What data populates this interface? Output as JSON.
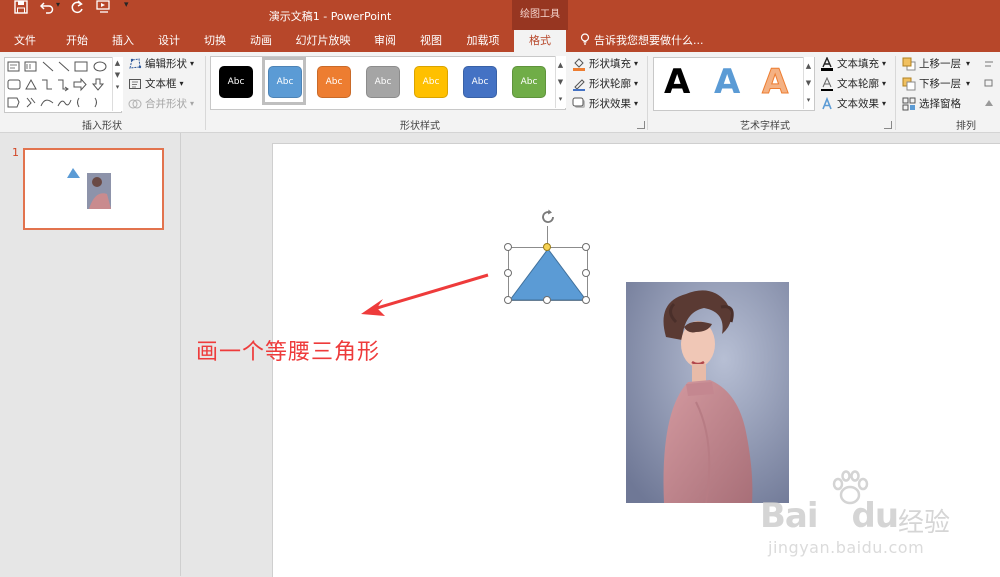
{
  "window": {
    "title": "演示文稿1 - PowerPoint",
    "context_tab_label": "绘图工具"
  },
  "quick_access": {
    "icons": [
      "save-icon",
      "undo-icon",
      "undo-dropdown-icon",
      "redo-icon",
      "start-from-beginning-icon",
      "customize-icon"
    ]
  },
  "tabs": [
    {
      "label": "文件"
    },
    {
      "label": "开始"
    },
    {
      "label": "插入"
    },
    {
      "label": "设计"
    },
    {
      "label": "切换"
    },
    {
      "label": "动画"
    },
    {
      "label": "幻灯片放映"
    },
    {
      "label": "审阅"
    },
    {
      "label": "视图"
    },
    {
      "label": "加载项"
    },
    {
      "label": "格式",
      "active": true
    }
  ],
  "tell_me": "告诉我您想要做什么...",
  "ribbon": {
    "insert_shapes": {
      "label": "插入形状",
      "edit_shape": "编辑形状",
      "text_box": "文本框",
      "merge_shapes": "合并形状"
    },
    "shape_styles": {
      "label": "形状样式",
      "sample_text": "Abc",
      "presets": [
        {
          "fill": "#000000",
          "text_color": "#ffffff"
        },
        {
          "fill": "#5b9bd5",
          "text_color": "#ffffff",
          "selected": true
        },
        {
          "fill": "#ed7d31",
          "text_color": "#ffffff"
        },
        {
          "fill": "#a5a5a5",
          "text_color": "#ffffff"
        },
        {
          "fill": "#ffc000",
          "text_color": "#ffffff"
        },
        {
          "fill": "#4472c4",
          "text_color": "#ffffff"
        },
        {
          "fill": "#70ad47",
          "text_color": "#ffffff"
        }
      ],
      "shape_fill": "形状填充",
      "shape_outline": "形状轮廓",
      "shape_effects": "形状效果"
    },
    "wordart_styles": {
      "label": "艺术字样式",
      "samples": [
        {
          "text": "A",
          "color": "#000000"
        },
        {
          "text": "A",
          "color": "#5b9bd5"
        },
        {
          "text": "A",
          "color": "#f4b183"
        }
      ],
      "text_fill": "文本填充",
      "text_outline": "文本轮廓",
      "text_effects": "文本效果"
    },
    "arrange": {
      "label": "排列",
      "bring_forward": "上移一层",
      "send_backward": "下移一层",
      "selection_pane": "选择窗格"
    }
  },
  "thumbnail_pane": {
    "slide_number": "1"
  },
  "slide": {
    "annotation": "画一个等腰三角形",
    "triangle_fill": "#5b9bd5",
    "arrow_color": "#ee3b3b"
  },
  "watermark": {
    "brand": "Bai",
    "brand2": "du",
    "suffix": "经验",
    "url": "jingyan.baidu.com"
  },
  "colors": {
    "accent": "#b7472a",
    "context_tab": "#973621",
    "thumb_border": "#e2734e"
  }
}
